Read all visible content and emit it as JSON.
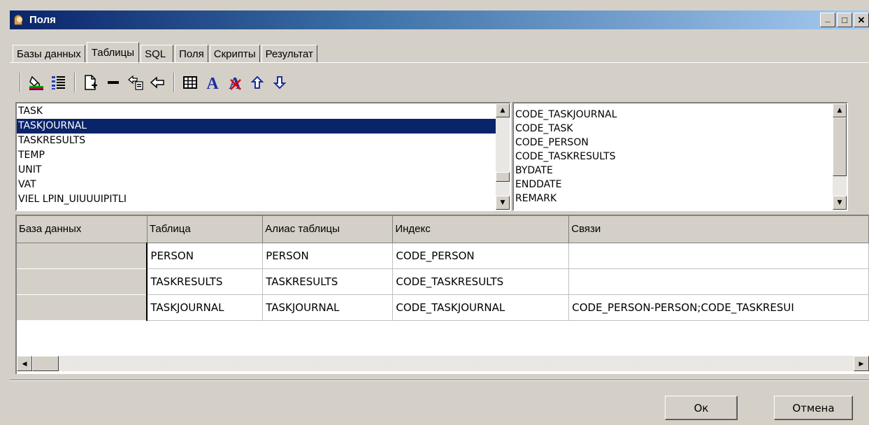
{
  "window": {
    "title": "Поля",
    "minimize": "_",
    "maximize": "□",
    "close": "×"
  },
  "tabs": [
    "Базы данных",
    "Таблицы",
    "SQL",
    "Поля",
    "Скрипты",
    "Результат"
  ],
  "active_tab": "Таблицы",
  "toolbar": {
    "icons": [
      "paint-bucket-icon",
      "numbered-list-icon",
      "new-document-icon",
      "remove-icon",
      "add-link-icon",
      "remove-link-icon",
      "grid-icon",
      "font-icon",
      "remove-font-icon",
      "arrow-up-icon",
      "arrow-down-icon"
    ]
  },
  "tables_list": {
    "items": [
      "TASK",
      "TASKJOURNAL",
      "TASKRESULTS",
      "TEMP",
      "UNIT",
      "VAT",
      "VIEL LPIN_UIUUUIPITLI"
    ],
    "selected": "TASKJOURNAL"
  },
  "fields_list": {
    "items": [
      "CODE_TASKJOURNAL",
      "CODE_TASK",
      "CODE_PERSON",
      "CODE_TASKRESULTS",
      "BYDATE",
      "ENDDATE",
      "REMARK"
    ]
  },
  "grid": {
    "headers": [
      "База данных",
      "Таблица",
      "Алиас таблицы",
      "Индекс",
      "Связи"
    ],
    "rows": [
      [
        "",
        "PERSON",
        "PERSON",
        "CODE_PERSON",
        ""
      ],
      [
        "",
        "TASKRESULTS",
        "TASKRESULTS",
        "CODE_TASKRESULTS",
        ""
      ],
      [
        "",
        "TASKJOURNAL",
        "TASKJOURNAL",
        "CODE_TASKJOURNAL",
        "CODE_PERSON-PERSON;CODE_TASKRESUI"
      ]
    ]
  },
  "buttons": {
    "ok": "Ок",
    "cancel": "Отмена"
  },
  "colors": {
    "selection": "#0a246a",
    "face": "#d4d0c8",
    "title_start": "#0a246a",
    "title_end": "#a6caf0"
  }
}
